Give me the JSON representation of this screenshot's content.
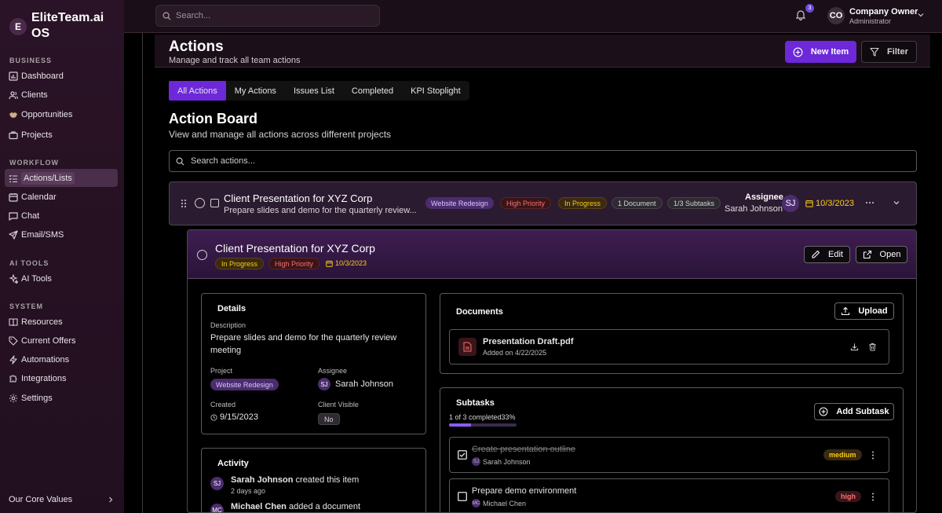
{
  "sidebar": {
    "logo_letter": "E",
    "brand": "EliteTeam.ai OS",
    "sections": {
      "business": "BUSINESS",
      "workflow": "WORKFLOW",
      "ai_tools": "AI TOOLS",
      "system": "SYSTEM"
    },
    "items": {
      "dashboard": "Dashboard",
      "clients": "Clients",
      "opportunities": "Opportunities",
      "projects": "Projects",
      "actions": "Actions/Lists",
      "calendar": "Calendar",
      "chat": "Chat",
      "email": "Email/SMS",
      "ai_tools": "AI Tools",
      "resources": "Resources",
      "offers": "Current Offers",
      "automations": "Automations",
      "integrations": "Integrations",
      "settings": "Settings"
    },
    "core_values": "Our Core Values"
  },
  "topbar": {
    "search_placeholder": "Search...",
    "notif_count": "3",
    "avatar": "CO",
    "user_name": "Company Owner",
    "user_role": "Administrator"
  },
  "header": {
    "title": "Actions",
    "subtitle": "Manage and track all team actions",
    "new_item": "New Item",
    "filter": "Filter"
  },
  "tabs": [
    "All Actions",
    "My Actions",
    "Issues List",
    "Completed",
    "KPI Stoplight"
  ],
  "board": {
    "title": "Action Board",
    "subtitle": "View and manage all actions across different projects",
    "search_placeholder": "Search actions..."
  },
  "action": {
    "title": "Client Presentation for XYZ Corp",
    "desc": "Prepare slides and demo for the quarterly review...",
    "project": "Website Redesign",
    "priority": "High Priority",
    "status": "In Progress",
    "documents": "1 Document",
    "subtasks": "1/3 Subtasks",
    "assignee_label": "Assignee",
    "assignee": "Sarah Johnson",
    "assignee_initials": "SJ",
    "date": "10/3/2023"
  },
  "detail": {
    "title": "Client Presentation for XYZ Corp",
    "status": "In Progress",
    "priority": "High Priority",
    "date": "10/3/2023",
    "edit": "Edit",
    "open": "Open",
    "details": {
      "title": "Details",
      "description_label": "Description",
      "description_line1": "Prepare slides and demo for the quarterly review",
      "description_line2": "meeting",
      "project_label": "Project",
      "project": "Website Redesign",
      "assignee_label": "Assignee",
      "assignee_initials": "SJ",
      "assignee": "Sarah Johnson",
      "created_label": "Created",
      "created": "9/15/2023",
      "client_visible_label": "Client Visible",
      "client_visible": "No"
    },
    "activity": {
      "title": "Activity",
      "items": [
        {
          "initials": "SJ",
          "name": "Sarah Johnson",
          "action": "created this item",
          "time": "2 days ago"
        },
        {
          "initials": "MC",
          "name": "Michael Chen",
          "action": "added a document",
          "time": ""
        }
      ]
    },
    "documents": {
      "title": "Documents",
      "upload": "Upload",
      "file_name": "Presentation Draft.pdf",
      "file_added": "Added on 4/22/2025"
    },
    "subtasks": {
      "title": "Subtasks",
      "progress_text": "1 of 3 completed",
      "progress_pct": "33%",
      "progress_value": 0.33,
      "add": "Add Subtask",
      "items": [
        {
          "title": "Create presentation outline",
          "initials": "SJ",
          "assignee": "Sarah Johnson",
          "priority": "medium",
          "done": true
        },
        {
          "title": "Prepare demo environment",
          "initials": "MC",
          "assignee": "Michael Chen",
          "priority": "high",
          "done": false
        }
      ]
    }
  },
  "colors": {
    "accent": "#6d28d9",
    "sidebar_bg": "#2a1326",
    "warning": "#facc15",
    "danger": "#f87171"
  }
}
